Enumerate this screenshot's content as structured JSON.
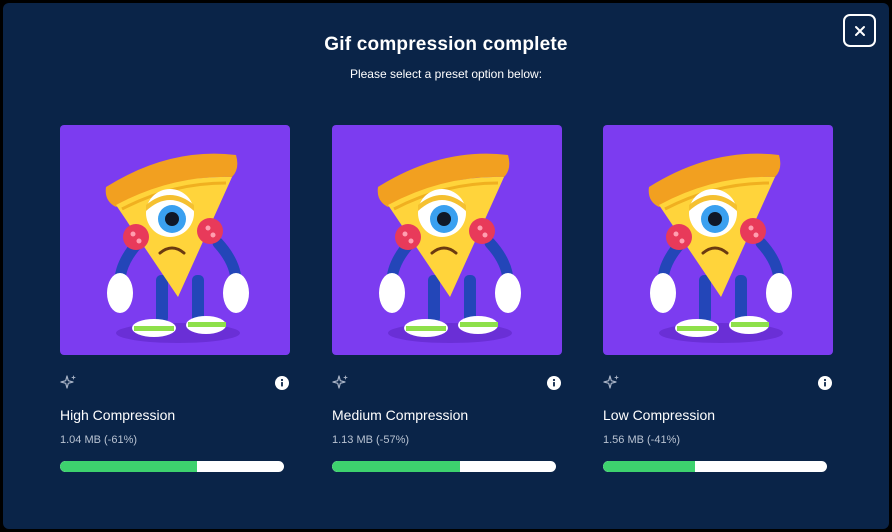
{
  "modal": {
    "title": "Gif compression complete",
    "subtitle": "Please select a preset option below:",
    "close_icon": "close-icon"
  },
  "colors": {
    "background": "#0a2448",
    "thumbnail_bg": "#7c3cf0",
    "progress_fill": "#3dd26e",
    "progress_track": "#ffffff"
  },
  "presets": [
    {
      "label": "High Compression",
      "size": "1.04 MB (-61%)",
      "progress": 0.61,
      "icons": [
        "sparkle-icon",
        "info-icon"
      ]
    },
    {
      "label": "Medium Compression",
      "size": "1.13 MB (-57%)",
      "progress": 0.57,
      "icons": [
        "sparkle-icon",
        "info-icon"
      ]
    },
    {
      "label": "Low Compression",
      "size": "1.56 MB (-41%)",
      "progress": 0.41,
      "icons": [
        "sparkle-icon",
        "info-icon"
      ]
    }
  ]
}
